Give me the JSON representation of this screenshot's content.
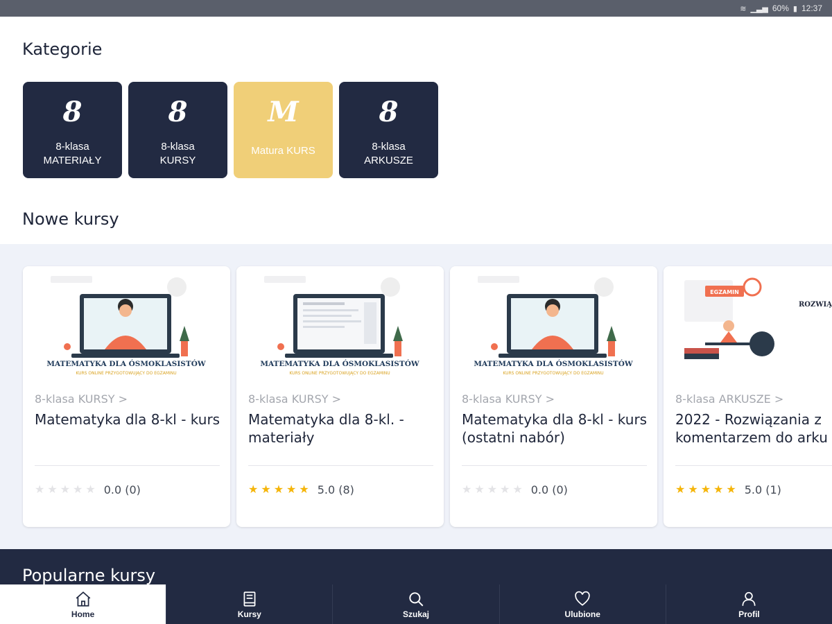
{
  "status_bar": {
    "battery": "60%",
    "time": "12:37"
  },
  "sections": {
    "categories_title": "Kategorie",
    "new_courses_title": "Nowe kursy",
    "popular_title": "Popularne kursy"
  },
  "categories": [
    {
      "glyph": "8",
      "line1": "8-klasa",
      "line2": "MATERIAŁY"
    },
    {
      "glyph": "8",
      "line1": "8-klasa",
      "line2": "KURSY"
    },
    {
      "glyph": "M",
      "line1": "Matura KURS",
      "line2": ""
    },
    {
      "glyph": "8",
      "line1": "8-klasa",
      "line2": "ARKUSZE"
    }
  ],
  "courses": [
    {
      "category": "8-klasa KURSY >",
      "title": "Matematyka dla 8-kl - kurs",
      "rating_value": "0.0 (0)",
      "stars": 0,
      "thumb_banner": "MATEMATYKA DLA ÓSMOKLASISTÓW",
      "thumb_sub": "KURS ONLINE PRZYGOTOWUJĄCY DO EGZAMINU"
    },
    {
      "category": "8-klasa KURSY >",
      "title": "Matematyka dla 8-kl. - materiały",
      "rating_value": "5.0 (8)",
      "stars": 5,
      "thumb_banner": "MATEMATYKA DLA ÓSMOKLASISTÓW",
      "thumb_sub": "KURS ONLINE PRZYGOTOWUJĄCY DO EGZAMINU"
    },
    {
      "category": "8-klasa KURSY >",
      "title": "Matematyka dla 8-kl - kurs (ostatni nabór)",
      "rating_value": "0.0 (0)",
      "stars": 0,
      "thumb_banner": "MATEMATYKA DLA ÓSMOKLASISTÓW",
      "thumb_sub": "KURS ONLINE PRZYGOTOWUJĄCY DO EGZAMINU"
    },
    {
      "category": "8-klasa ARKUSZE >",
      "title": "2022 - Rozwiązania z komentarzem do arku",
      "rating_value": "5.0 (1)",
      "stars": 5,
      "thumb_banner": "ROZWIĄ Z KOMENTAR",
      "thumb_sub": "EGZAMIN"
    }
  ],
  "bottom_nav": [
    {
      "label": "Home",
      "icon": "home-icon"
    },
    {
      "label": "Kursy",
      "icon": "book-icon"
    },
    {
      "label": "Szukaj",
      "icon": "search-icon"
    },
    {
      "label": "Ulubione",
      "icon": "heart-icon"
    },
    {
      "label": "Profil",
      "icon": "user-icon"
    }
  ],
  "colors": {
    "navy": "#222a42",
    "accent_yellow": "#f0cf78",
    "star": "#f5b50a",
    "band": "#eff2f9"
  }
}
